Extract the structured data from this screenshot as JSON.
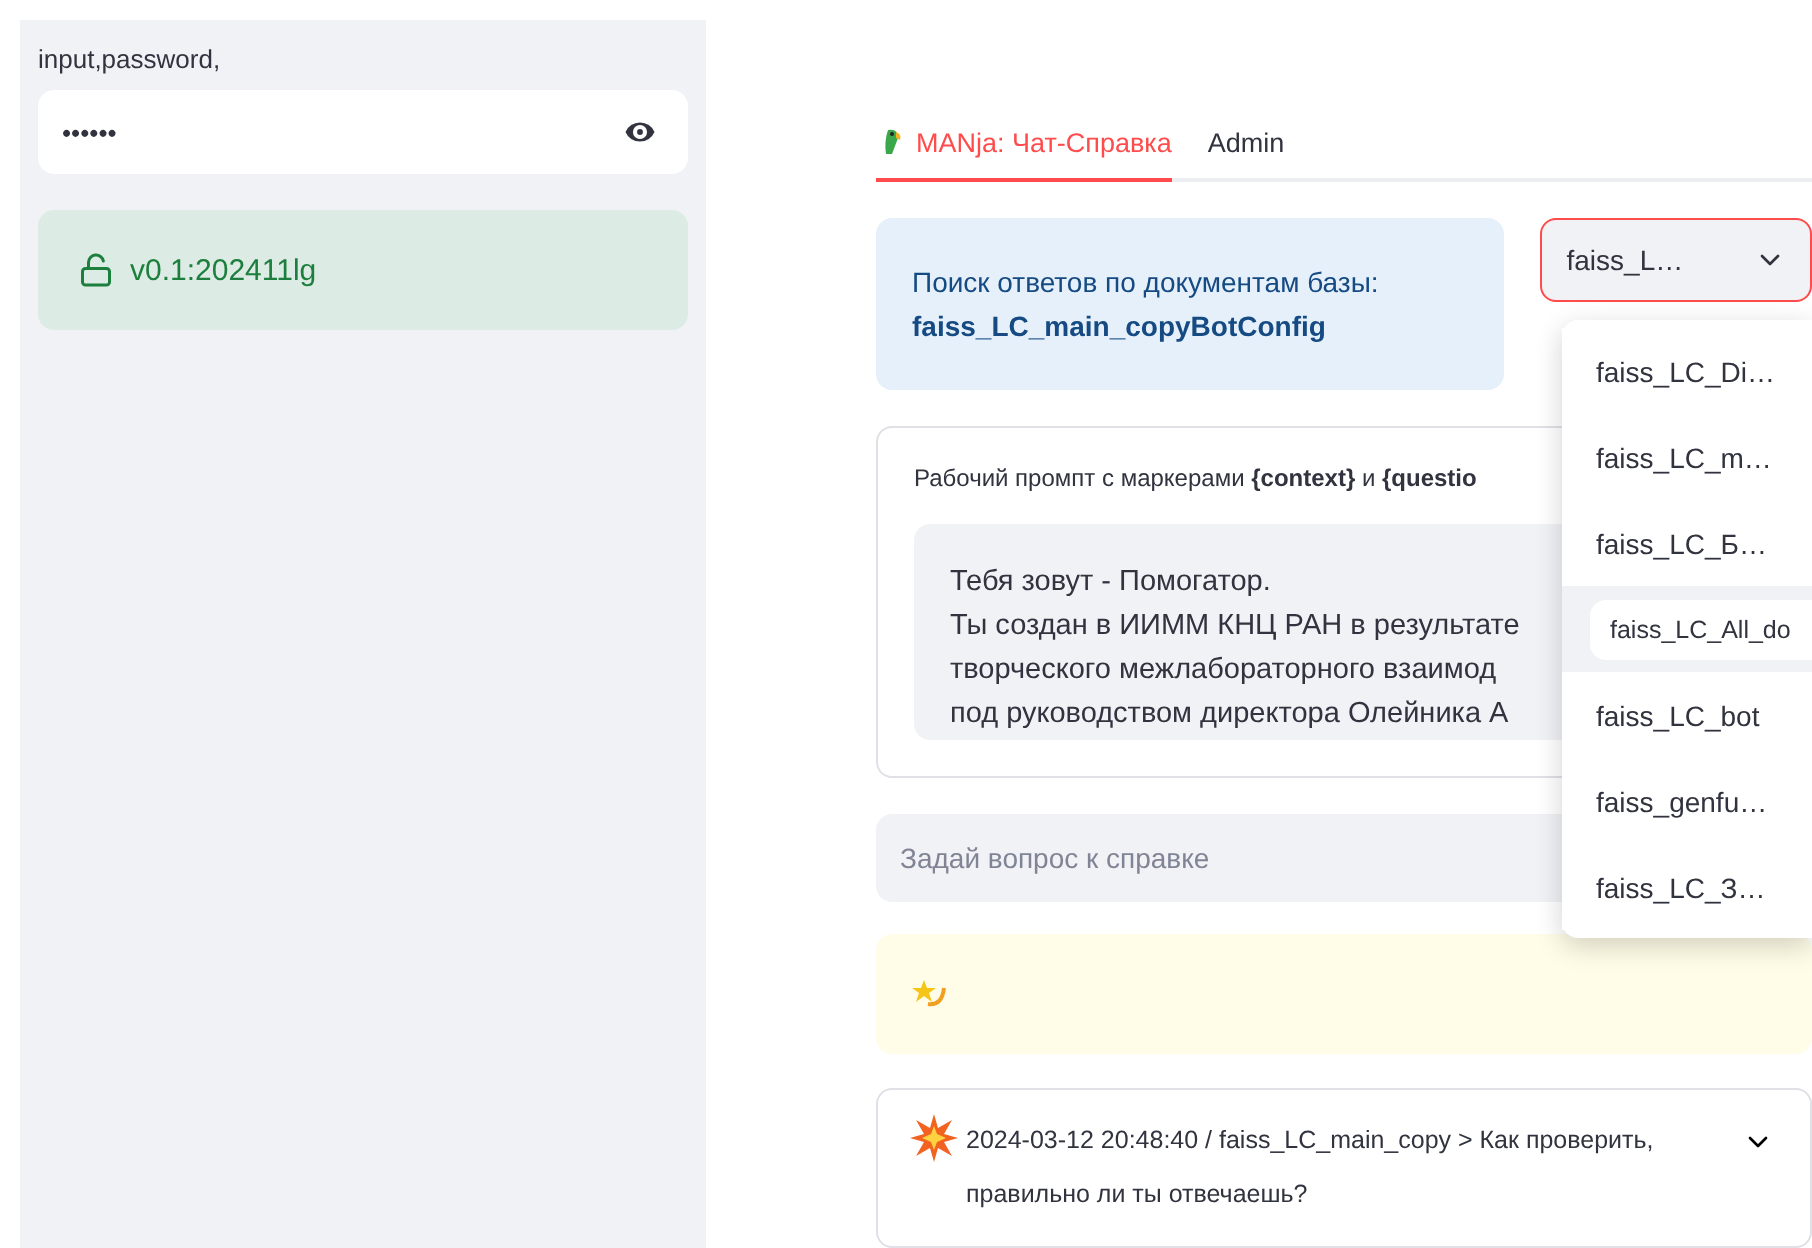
{
  "sidebar": {
    "label": "input,password,",
    "password": {
      "value": "••••••",
      "revealed": false
    },
    "status": {
      "text": "v0.1:202411lg",
      "kind": "success"
    }
  },
  "tabs": [
    {
      "label": "MANja: Чат-Справка",
      "selected": true,
      "kind": "emoji"
    },
    {
      "label": "Admin",
      "selected": false,
      "kind": "plain"
    }
  ],
  "info": {
    "text": "Поиск ответов по документам базы:",
    "base": "faiss_LC_main_copyBotConfig"
  },
  "select": {
    "value": "faiss_L…",
    "open": true,
    "options": [
      {
        "label": "faiss_LC_Di…",
        "highlighted": false
      },
      {
        "label": "faiss_LC_m…",
        "highlighted": false
      },
      {
        "label": "faiss_LC_Б…",
        "highlighted": false
      },
      {
        "label": "faiss_LC_All_do",
        "highlighted": true
      },
      {
        "label": "faiss_LC_bot",
        "highlighted": false
      },
      {
        "label": "faiss_genfu…",
        "highlighted": false
      },
      {
        "label": "faiss_LC_З…",
        "highlighted": false
      }
    ]
  },
  "prompt": {
    "label": "Рабочий промпт с маркерами **{context}** и **{questio**",
    "lines": [
      "Тебя зовут - Помогатор.",
      "Ты создан в ИИММ КНЦ РАН в результате",
      "творческого межлабораторного взаимод",
      "под руководством директора Олейника А"
    ]
  },
  "question": {
    "placeholder": "Задай вопрос к справке"
  },
  "notice": {
    "kind": "warning"
  },
  "history": [
    {
      "text": "2024-03-12 20:48:40 / faiss_LC_main_copy > Как проверить, правильно ли ты отвечаешь?",
      "expanded": false
    }
  ]
}
